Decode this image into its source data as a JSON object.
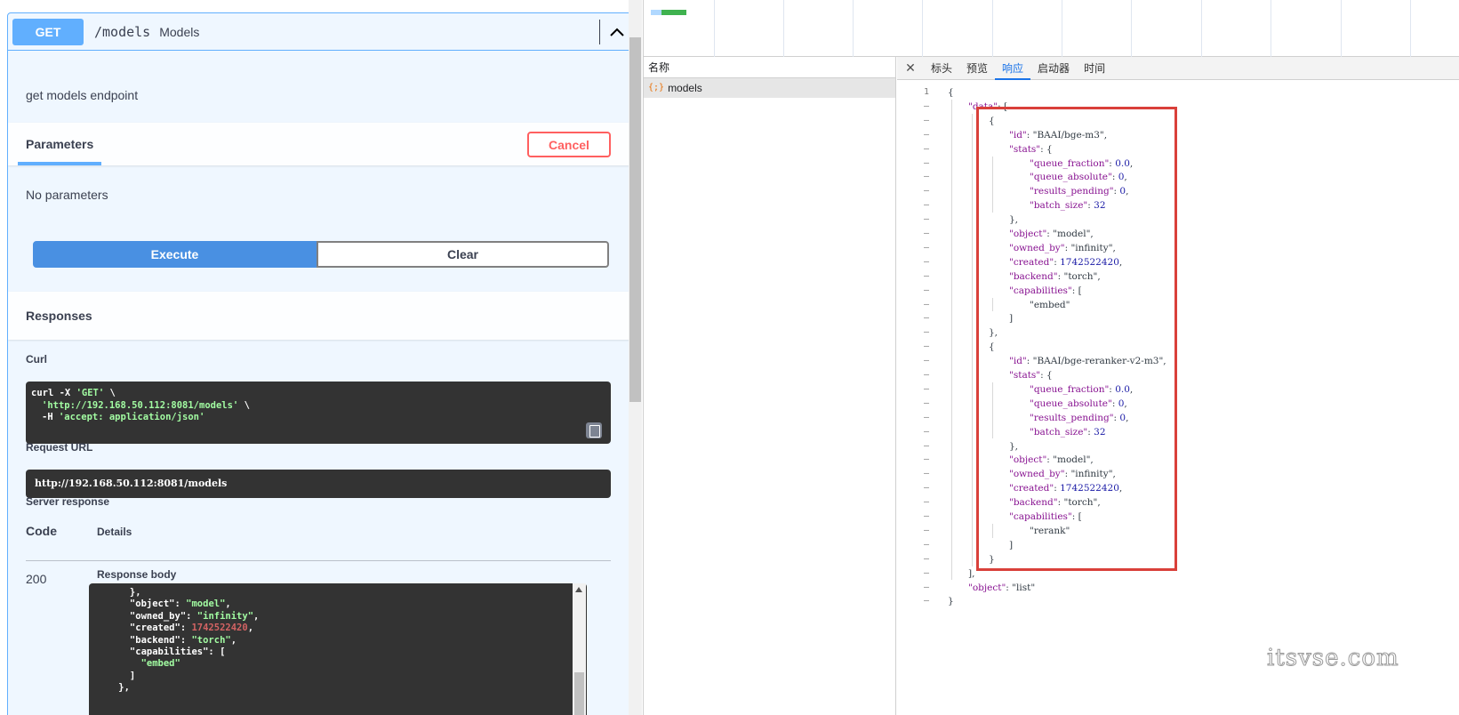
{
  "swagger": {
    "method": "GET",
    "path": "/models",
    "summary": "Models",
    "description": "get models endpoint",
    "parameters_title": "Parameters",
    "cancel_label": "Cancel",
    "no_parameters": "No parameters",
    "execute_label": "Execute",
    "clear_label": "Clear",
    "responses_title": "Responses",
    "curl_label": "Curl",
    "curl_lines": [
      "curl -X 'GET' \\",
      "'http://192.168.50.112:8081/models' \\",
      "-H 'accept: application/json'"
    ],
    "request_url_label": "Request URL",
    "request_url": "http://192.168.50.112:8081/models",
    "server_response_label": "Server response",
    "code_header": "Code",
    "details_header": "Details",
    "status_code": "200",
    "response_body_label": "Response body"
  },
  "devtools": {
    "name_header": "名称",
    "request_name": "models",
    "tabs": [
      "标头",
      "预览",
      "响应",
      "启动器",
      "时间"
    ],
    "active_tab": "响应"
  },
  "watermark": "itsvse.com"
}
